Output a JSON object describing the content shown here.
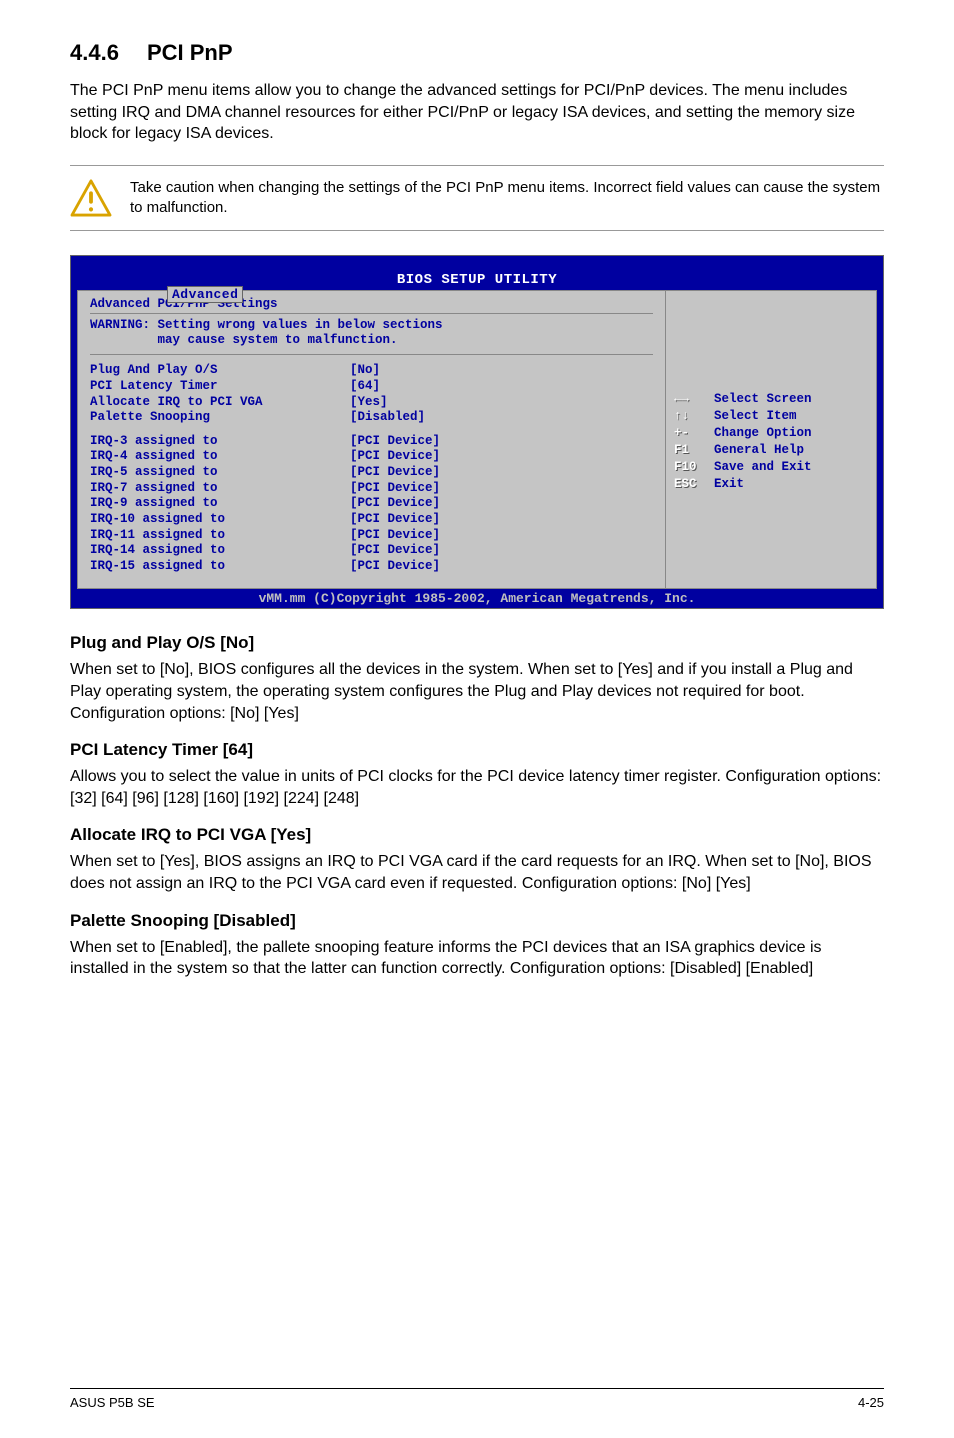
{
  "section": {
    "number": "4.4.6",
    "title": "PCI PnP"
  },
  "intro": "The PCI PnP menu items allow you to change the advanced settings for PCI/PnP devices. The menu includes setting IRQ and DMA channel resources for either PCI/PnP or legacy ISA devices, and setting the memory size block for legacy ISA devices.",
  "caution": "Take caution when changing the settings of the PCI PnP menu items. Incorrect field values can cause the system to malfunction.",
  "bios": {
    "title": "BIOS SETUP UTILITY",
    "tab": "Advanced",
    "subtitle": "Advanced PCI/PnP Settings",
    "warning_line1": "WARNING: Setting wrong values in below sections",
    "warning_line2": "         may cause system to malfunction.",
    "settings": [
      {
        "label": "Plug And Play O/S",
        "value": "[No]"
      },
      {
        "label": "PCI Latency Timer",
        "value": "[64]"
      },
      {
        "label": "Allocate IRQ to PCI VGA",
        "value": "[Yes]"
      },
      {
        "label": "Palette Snooping",
        "value": "[Disabled]"
      }
    ],
    "irq": [
      {
        "label": "IRQ-3 assigned to",
        "value": "[PCI Device]"
      },
      {
        "label": "IRQ-4 assigned to",
        "value": "[PCI Device]"
      },
      {
        "label": "IRQ-5 assigned to",
        "value": "[PCI Device]"
      },
      {
        "label": "IRQ-7 assigned to",
        "value": "[PCI Device]"
      },
      {
        "label": "IRQ-9 assigned to",
        "value": "[PCI Device]"
      },
      {
        "label": "IRQ-10 assigned to",
        "value": "[PCI Device]"
      },
      {
        "label": "IRQ-11 assigned to",
        "value": "[PCI Device]"
      },
      {
        "label": "IRQ-14 assigned to",
        "value": "[PCI Device]"
      },
      {
        "label": "IRQ-15 assigned to",
        "value": "[PCI Device]"
      }
    ],
    "help": [
      {
        "key": "←→",
        "desc": "Select Screen"
      },
      {
        "key": "↑↓",
        "desc": "Select Item"
      },
      {
        "key": "+-",
        "desc": "Change Option"
      },
      {
        "key": "F1",
        "desc": "General Help"
      },
      {
        "key": "F10",
        "desc": "Save and Exit"
      },
      {
        "key": "ESC",
        "desc": "Exit"
      }
    ],
    "footer": "vMM.mm (C)Copyright 1985-2002, American Megatrends, Inc."
  },
  "subsections": [
    {
      "heading": "Plug and Play O/S [No]",
      "body": "When set to [No], BIOS configures all the devices in the system. When set to [Yes] and if you install a Plug and Play operating system, the operating system configures the Plug and Play devices not required for boot. Configuration options: [No] [Yes]"
    },
    {
      "heading": "PCI Latency Timer [64]",
      "body": "Allows you to select the value in units of PCI clocks for the PCI device latency timer register. Configuration options: [32] [64] [96] [128] [160] [192] [224] [248]"
    },
    {
      "heading": "Allocate IRQ to PCI VGA [Yes]",
      "body": "When set to [Yes], BIOS assigns an IRQ to PCI VGA card if the card requests for an IRQ. When set to [No], BIOS does not assign an IRQ to the PCI VGA card even if requested. Configuration options: [No] [Yes]"
    },
    {
      "heading": "Palette Snooping [Disabled]",
      "body": "When set to [Enabled], the pallete snooping feature informs the PCI devices that an ISA graphics device is installed in the system so that the latter can function correctly. Configuration options: [Disabled] [Enabled]"
    }
  ],
  "footer": {
    "left": "ASUS P5B SE",
    "right": "4-25"
  }
}
